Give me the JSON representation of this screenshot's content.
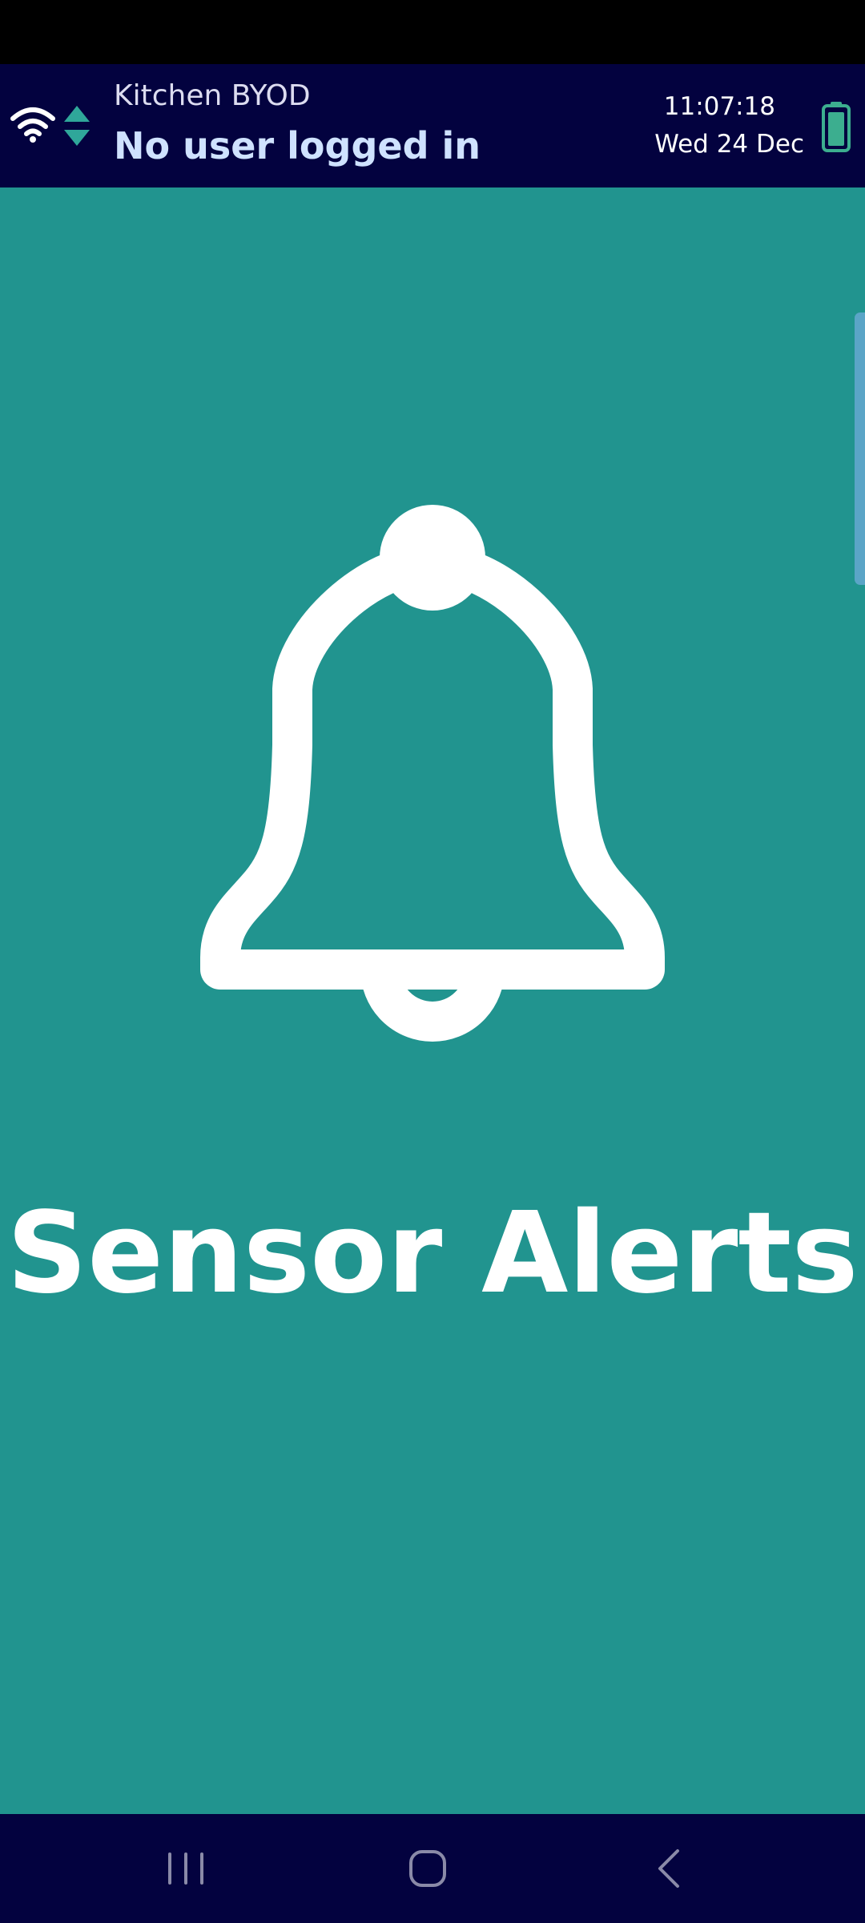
{
  "header": {
    "location": "Kitchen BYOD",
    "user_status": "No user logged in",
    "time": "11:07:18",
    "date": "Wed 24 Dec"
  },
  "main": {
    "tile_title": "Sensor Alerts",
    "icon": "bell-icon"
  },
  "icons": {
    "wifi": "wifi-icon",
    "sync": "sync-icon",
    "battery": "battery-icon",
    "nav_recents": "recents-icon",
    "nav_home": "home-icon",
    "nav_back": "back-icon"
  },
  "colors": {
    "header_bg": "#03023f",
    "tile_bg": "#21948f",
    "accent": "#2fa79a"
  }
}
